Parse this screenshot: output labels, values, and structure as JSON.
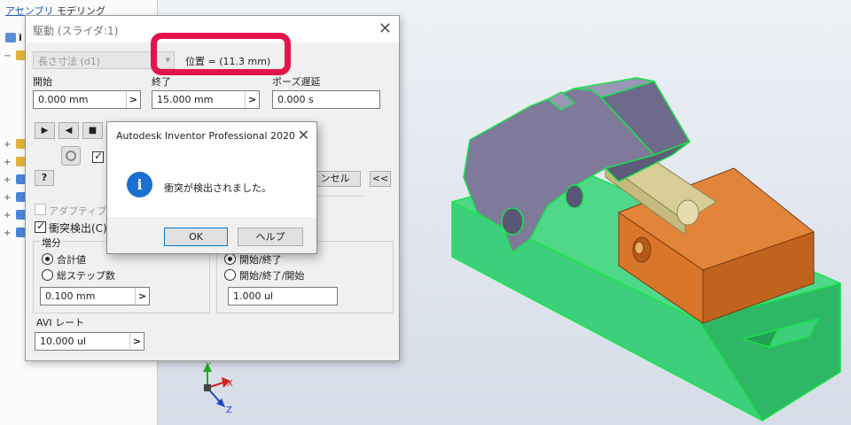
{
  "browser": {
    "tab_assembly": "アセンブリ",
    "tab_modeling": "モデリング",
    "root_letter": "i"
  },
  "dialog": {
    "title": "駆動 (スライダ:1)",
    "dimension_select": "長さ寸法 (d1)",
    "position_readout": "位置 = (11.3 mm)",
    "start_label": "開始",
    "start_value": "0.000 mm",
    "end_label": "終了",
    "end_value": "15.000 mm",
    "pause_label": "ポーズ遅延",
    "pause_value": "0.000 s",
    "cancel_partial": "ンセル",
    "collapse_label": "<<",
    "help_icon": "?",
    "adaptive_label": "アダプティブ駆動",
    "adaptive_checked": false,
    "collision_label": "衝突検出(C)",
    "collision_checked": true,
    "increment_group": "増分",
    "total_value_label": "合計値",
    "total_steps_label": "総ステップ数",
    "increment_value": "0.100 mm",
    "increment_mode": "total_value",
    "repeat_start_end": "開始/終了",
    "repeat_start_end_start": "開始/終了/開始",
    "repeat_mode": "start_end",
    "repeat_value": "1.000 ul",
    "avi_label": "AVI レート",
    "avi_value": "10.000 ul",
    "go_arrow": ">"
  },
  "message_box": {
    "title": "Autodesk Inventor Professional 2020",
    "icon": "info-icon",
    "text": "衝突が検出されました。",
    "ok_label": "OK",
    "help_label": "ヘルプ"
  },
  "triad": {
    "x_label": "X",
    "y_label": "Y",
    "z_label": "Z"
  },
  "colors": {
    "highlight": "#e4144a",
    "base_block": "#3ecf7c",
    "slider_block": "#d9762a",
    "arm": "#7f7a9a",
    "pin": "#d8cd96",
    "edge": "#19e34b"
  }
}
